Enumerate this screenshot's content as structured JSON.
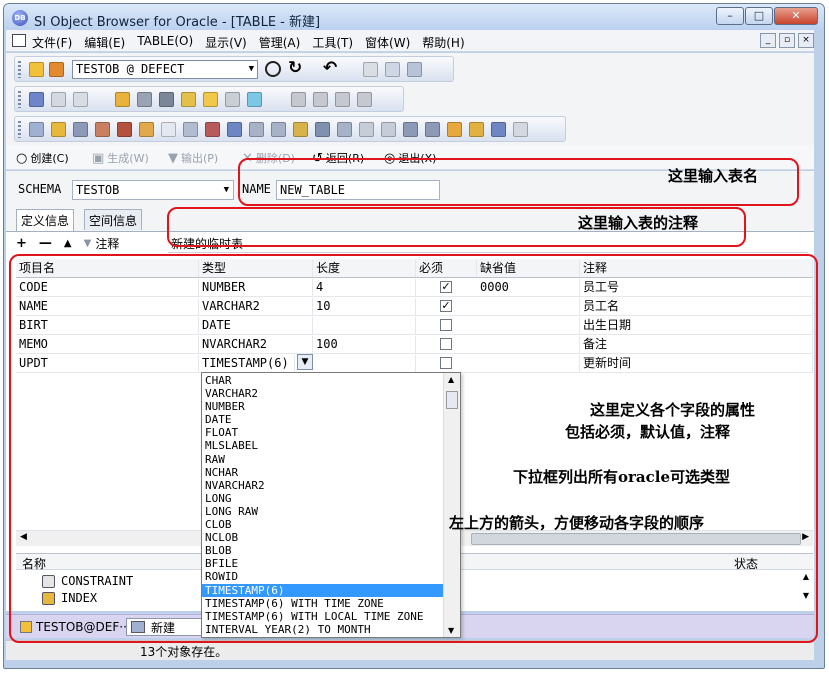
{
  "window": {
    "title": "SI Object Browser for Oracle - [TABLE - 新建]",
    "app_icon": "DB"
  },
  "window_buttons": {
    "minimize": "–",
    "maximize": "□",
    "close": "✕"
  },
  "menu": {
    "items": [
      "文件(F)",
      "编辑(E)",
      "TABLE(O)",
      "显示(V)",
      "管理(A)",
      "工具(T)",
      "窗体(W)",
      "帮助(H)"
    ],
    "mdi": [
      "_",
      "▫",
      "×"
    ]
  },
  "connection": {
    "value": "TESTOB @ DEFECT",
    "arrow": "▼"
  },
  "actions": [
    {
      "label": "创建(C)",
      "symbol": "○",
      "enabled": true
    },
    {
      "label": "生成(W)",
      "symbol": "▣",
      "enabled": false
    },
    {
      "label": "输出(P)",
      "symbol": "▼",
      "enabled": false
    },
    {
      "label": "删除(D)",
      "symbol": "✕",
      "enabled": false
    },
    {
      "label": "返回(R)",
      "symbol": "↺",
      "enabled": true
    },
    {
      "label": "退出(X)",
      "symbol": "◎",
      "enabled": true
    }
  ],
  "form": {
    "schema_label": "SCHEMA",
    "schema_value": "TESTOB",
    "name_label": "NAME",
    "name_value": "NEW_TABLE"
  },
  "tabs": [
    "定义信息",
    "空间信息"
  ],
  "rowtools": {
    "add": "+",
    "remove": "—",
    "up": "▲",
    "down": "▼",
    "comment_label": "注释"
  },
  "table_comment": "新建的临时表",
  "columns": [
    "项目名",
    "类型",
    "长度",
    "必须",
    "缺省值",
    "注释"
  ],
  "rows": [
    {
      "name": "CODE",
      "type": "NUMBER",
      "length": "4",
      "required": true,
      "default": "0000",
      "comment": "员工号"
    },
    {
      "name": "NAME",
      "type": "VARCHAR2",
      "length": "10",
      "required": true,
      "default": "",
      "comment": "员工名"
    },
    {
      "name": "BIRT",
      "type": "DATE",
      "length": "",
      "required": false,
      "default": "",
      "comment": "出生日期"
    },
    {
      "name": "MEMO",
      "type": "NVARCHAR2",
      "length": "100",
      "required": false,
      "default": "",
      "comment": "备注"
    },
    {
      "name": "UPDT",
      "type": "TIMESTAMP(6)",
      "length": "",
      "required": false,
      "default": "",
      "comment": "更新时间"
    }
  ],
  "type_options": [
    "CHAR",
    "VARCHAR2",
    "NUMBER",
    "DATE",
    "FLOAT",
    "MLSLABEL",
    "RAW",
    "NCHAR",
    "NVARCHAR2",
    "LONG",
    "LONG RAW",
    "CLOB",
    "NCLOB",
    "BLOB",
    "BFILE",
    "ROWID",
    "TIMESTAMP(6)",
    "TIMESTAMP(6) WITH TIME ZONE",
    "TIMESTAMP(6) WITH LOCAL TIME ZONE",
    "INTERVAL YEAR(2) TO MONTH"
  ],
  "selected_type": "TIMESTAMP(6)",
  "tree": {
    "header_name": "名称",
    "header_status": "状态",
    "items": [
      "CONSTRAINT",
      "INDEX"
    ]
  },
  "taskbar": [
    "TESTOB@DEF···",
    "新建"
  ],
  "status": "13个对象存在。",
  "annotations": {
    "table_name": "这里输入表名",
    "table_comment": "这里输入表的注释",
    "fields_line1": "这里定义各个字段的属性",
    "fields_line2": "包括必须，默认值，注释",
    "dropdown": "下拉框列出所有oracle可选类型",
    "arrows": "左上方的箭头，方便移动各字段的顺序"
  },
  "colors": {
    "annotation": "#e0151b",
    "selection": "#3399ff",
    "taskbar": "#d9d4ef"
  }
}
